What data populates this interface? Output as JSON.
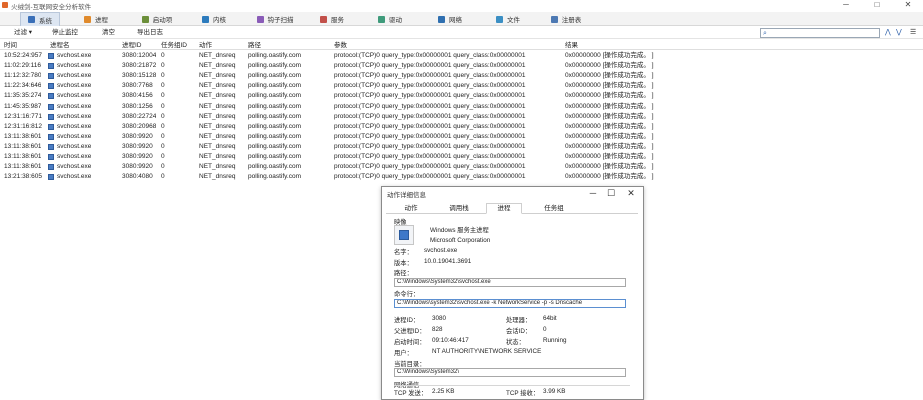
{
  "window": {
    "title": "火绒剑-互联网安全分析软件",
    "minimize": "─",
    "maximize": "□",
    "close": "✕"
  },
  "tabs": [
    {
      "label": "系统",
      "color": "#3a6fb8"
    },
    {
      "label": "进程",
      "color": "#e08a2c"
    },
    {
      "label": "启动项",
      "color": "#6c8f3a"
    },
    {
      "label": "内核",
      "color": "#2d7bbd"
    },
    {
      "label": "钩子扫描",
      "color": "#8a5cb8"
    },
    {
      "label": "服务",
      "color": "#c2504a"
    },
    {
      "label": "驱动",
      "color": "#3f9b7b"
    },
    {
      "label": "网络",
      "color": "#2f6fb0"
    },
    {
      "label": "文件",
      "color": "#3b8fc4"
    },
    {
      "label": "注册表",
      "color": "#4d79b3"
    }
  ],
  "toolbar": {
    "filter": "过滤 ▾",
    "stop": "停止监控",
    "clear": "清空",
    "export": "导出日志",
    "search_placeholder": "",
    "up": "⋀",
    "down": "⋁",
    "menu": "☰"
  },
  "table": {
    "columns": [
      "时间",
      "进程名",
      "进程ID",
      "任务组ID",
      "动作",
      "路径",
      "参数",
      "结果"
    ],
    "rows": [
      [
        "10:52:24:957",
        "svchost.exe",
        "3080:12004",
        "0",
        "NET_dnsreq",
        "polling.oastify.com",
        "protocol:(TCP)0 query_type:0x00000001 query_class:0x00000001",
        "0x00000000 [操作成功完成。 ]"
      ],
      [
        "11:02:29:116",
        "svchost.exe",
        "3080:21872",
        "0",
        "NET_dnsreq",
        "polling.oastify.com",
        "protocol:(TCP)0 query_type:0x00000001 query_class:0x00000001",
        "0x00000000 [操作成功完成。 ]"
      ],
      [
        "11:12:32:780",
        "svchost.exe",
        "3080:15128",
        "0",
        "NET_dnsreq",
        "polling.oastify.com",
        "protocol:(TCP)0 query_type:0x00000001 query_class:0x00000001",
        "0x00000000 [操作成功完成。 ]"
      ],
      [
        "11:22:34:646",
        "svchost.exe",
        "3080:7768",
        "0",
        "NET_dnsreq",
        "polling.oastify.com",
        "protocol:(TCP)0 query_type:0x00000001 query_class:0x00000001",
        "0x00000000 [操作成功完成。 ]"
      ],
      [
        "11:35:35:274",
        "svchost.exe",
        "3080:4156",
        "0",
        "NET_dnsreq",
        "polling.oastify.com",
        "protocol:(TCP)0 query_type:0x00000001 query_class:0x00000001",
        "0x00000000 [操作成功完成。 ]"
      ],
      [
        "11:45:35:987",
        "svchost.exe",
        "3080:1256",
        "0",
        "NET_dnsreq",
        "polling.oastify.com",
        "protocol:(TCP)0 query_type:0x00000001 query_class:0x00000001",
        "0x00000000 [操作成功完成。 ]"
      ],
      [
        "12:31:16:771",
        "svchost.exe",
        "3080:22724",
        "0",
        "NET_dnsreq",
        "polling.oastify.com",
        "protocol:(TCP)0 query_type:0x00000001 query_class:0x00000001",
        "0x00000000 [操作成功完成。 ]"
      ],
      [
        "12:31:16:812",
        "svchost.exe",
        "3080:20968",
        "0",
        "NET_dnsreq",
        "polling.oastify.com",
        "protocol:(TCP)0 query_type:0x00000001 query_class:0x00000001",
        "0x00000000 [操作成功完成。 ]"
      ],
      [
        "13:11:38:601",
        "svchost.exe",
        "3080:9920",
        "0",
        "NET_dnsreq",
        "polling.oastify.com",
        "protocol:(TCP)0 query_type:0x00000001 query_class:0x00000001",
        "0x00000000 [操作成功完成。 ]"
      ],
      [
        "13:11:38:601",
        "svchost.exe",
        "3080:9920",
        "0",
        "NET_dnsreq",
        "polling.oastify.com",
        "protocol:(TCP)0 query_type:0x00000001 query_class:0x00000001",
        "0x00000000 [操作成功完成。 ]"
      ],
      [
        "13:11:38:601",
        "svchost.exe",
        "3080:9920",
        "0",
        "NET_dnsreq",
        "polling.oastify.com",
        "protocol:(TCP)0 query_type:0x00000001 query_class:0x00000001",
        "0x00000000 [操作成功完成。 ]"
      ],
      [
        "13:11:38:601",
        "svchost.exe",
        "3080:9920",
        "0",
        "NET_dnsreq",
        "polling.oastify.com",
        "protocol:(TCP)0 query_type:0x00000001 query_class:0x00000001",
        "0x00000000 [操作成功完成。 ]"
      ],
      [
        "13:21:38:605",
        "svchost.exe",
        "3080:4080",
        "0",
        "NET_dnsreq",
        "polling.oastify.com",
        "protocol:(TCP)0 query_type:0x00000001 query_class:0x00000001",
        "0x00000000 [操作成功完成。 ]"
      ]
    ]
  },
  "dialog": {
    "title": "动作详细信息",
    "minimize": "─",
    "maximize": "☐",
    "close": "✕",
    "tabs": [
      "动作",
      "调用栈",
      "进程",
      "任务组"
    ],
    "image_label": "映像",
    "description": "Windows 服务主进程",
    "company": "Microsoft Corporation",
    "name_label": "名字：",
    "name_value": "svchost.exe",
    "version_label": "版本：",
    "version_value": "10.0.19041.3691",
    "path_label": "路径：",
    "path_value": "C:\\Windows\\System32\\svchost.exe",
    "cmdline_label": "命令行：",
    "cmdline_value": "C:\\Windows\\system32\\svchost.exe -k NetworkService -p -s Dnscache",
    "pid_label": "进程ID：",
    "pid_value": "3080",
    "arch_label": "处理器：",
    "arch_value": "64bit",
    "ppid_label": "父进程ID：",
    "ppid_value": "828",
    "session_label": "会话ID：",
    "session_value": "0",
    "start_label": "启动时间：",
    "start_value": "09:10:46:417",
    "status_label": "状态：",
    "status_value": "Running",
    "user_label": "用户：",
    "user_value": "NT AUTHORITY\\NETWORK SERVICE",
    "cwd_label": "当前目录：",
    "cwd_value": "C:\\Windows\\System32\\",
    "net_label": "网络通信",
    "tcp_send_label": "TCP 发送：",
    "tcp_send_value": "2.25 KB",
    "tcp_recv_label": "TCP 接收：",
    "tcp_recv_value": "3.99 KB"
  }
}
